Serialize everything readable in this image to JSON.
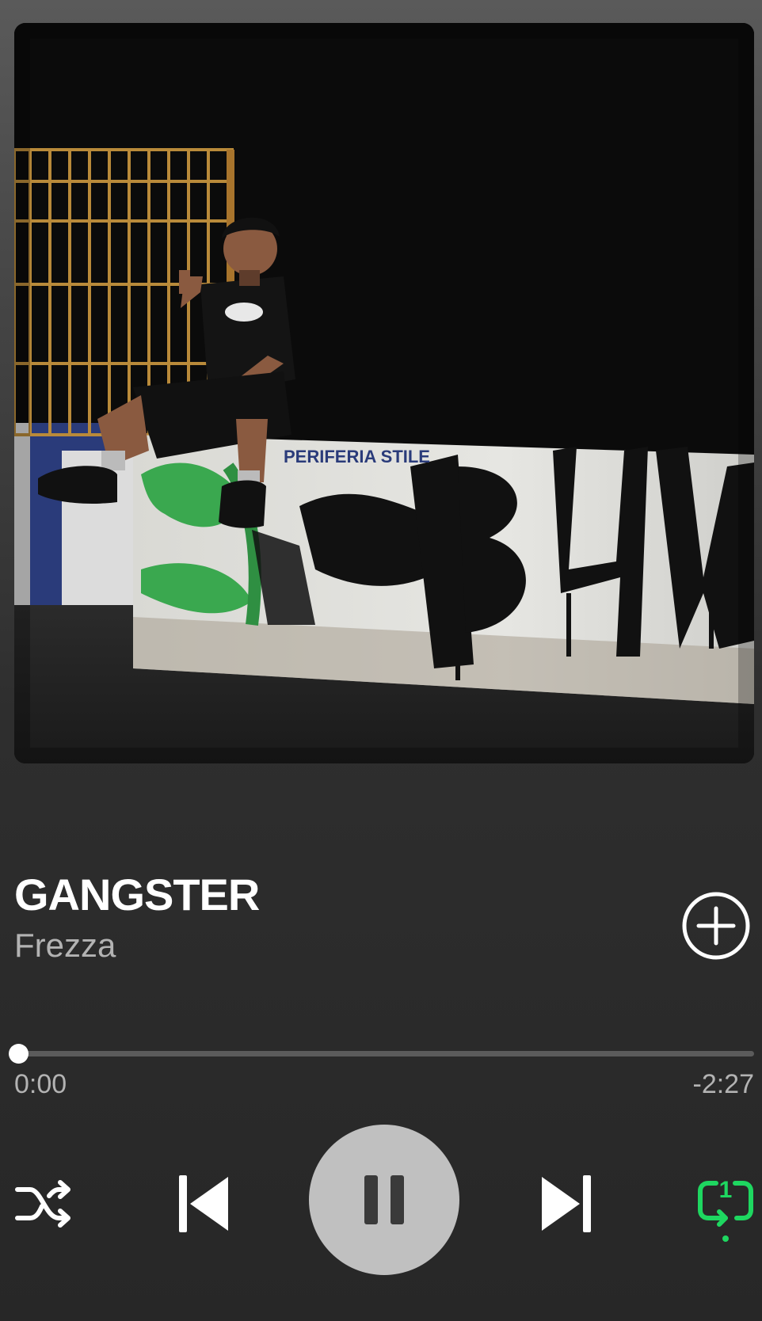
{
  "track": {
    "title": "GANGSTER",
    "artist": "Frezza"
  },
  "playback": {
    "elapsed": "0:00",
    "remaining": "-2:27",
    "progress_fraction": 0.0,
    "state": "playing",
    "shuffle": "off",
    "repeat": "one",
    "repeat_badge": "1"
  },
  "artwork": {
    "graffiti_text": "B4W",
    "sticker_text": "PERIFERIA STILE"
  },
  "icons": {
    "add": "add-circle-icon",
    "shuffle": "shuffle-icon",
    "previous": "skip-previous-icon",
    "pause": "pause-icon",
    "next": "skip-next-icon",
    "repeat": "repeat-one-icon"
  },
  "colors": {
    "accent": "#1ed760",
    "text_secondary": "#b3b3b3",
    "play_button": "#c0c0c0"
  }
}
